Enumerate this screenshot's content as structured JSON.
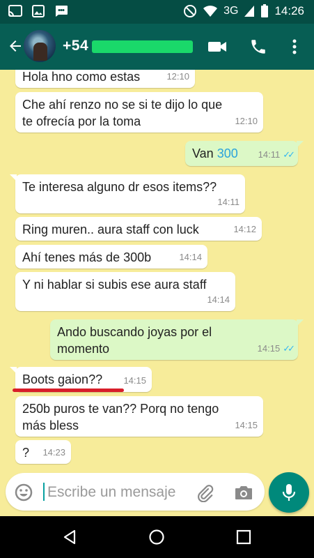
{
  "status_bar": {
    "network": "3G",
    "time": "14:26"
  },
  "header": {
    "contact": "+54",
    "back_icon": "arrow-left-icon",
    "video_icon": "videocam-icon",
    "call_icon": "phone-icon",
    "menu_icon": "more-vert-icon"
  },
  "messages": [
    {
      "dir": "in",
      "text": "Hola hno como estas",
      "time": "12:10"
    },
    {
      "dir": "in",
      "line1": "Che ahí renzo no se si te dijo lo que",
      "line2": "te ofrecía por la toma",
      "time": "12:10"
    },
    {
      "dir": "out",
      "text_prefix": "Van ",
      "text_highlight": "300",
      "time": "14:11",
      "status": "read"
    },
    {
      "dir": "in",
      "text": "Te interesa alguno dr esos items??",
      "time": "14:11"
    },
    {
      "dir": "in",
      "text": "Ring muren.. aura staff con luck",
      "time": "14:12"
    },
    {
      "dir": "in",
      "text": "Ahí tenes más de 300b",
      "time": "14:14"
    },
    {
      "dir": "in",
      "text": "Y ni hablar si subis ese aura staff",
      "time": "14:14"
    },
    {
      "dir": "out",
      "line1": "Ando buscando joyas por el",
      "line2": "momento",
      "time": "14:15",
      "status": "read"
    },
    {
      "dir": "in",
      "text": "Boots gaion??",
      "time": "14:15"
    },
    {
      "dir": "in",
      "line1": "250b puros te van?? Porq no tengo",
      "line2": "más bless",
      "time": "14:15"
    },
    {
      "dir": "in",
      "text": "?",
      "time": "14:23"
    }
  ],
  "composer": {
    "placeholder": "Escribe un mensaje",
    "emoji_icon": "emoji-icon",
    "attach_icon": "paperclip-icon",
    "camera_icon": "camera-icon",
    "mic_icon": "mic-icon"
  },
  "nav": {
    "back": "nav-back-icon",
    "home": "nav-home-icon",
    "recents": "nav-recents-icon"
  },
  "colors": {
    "header": "#075e54",
    "wallpaper": "#f7ec9a",
    "outgoing": "#dcf8c6",
    "incoming": "#ffffff",
    "accent": "#00897b",
    "redaction": "#1ad86a",
    "underline": "#d81e2a"
  }
}
